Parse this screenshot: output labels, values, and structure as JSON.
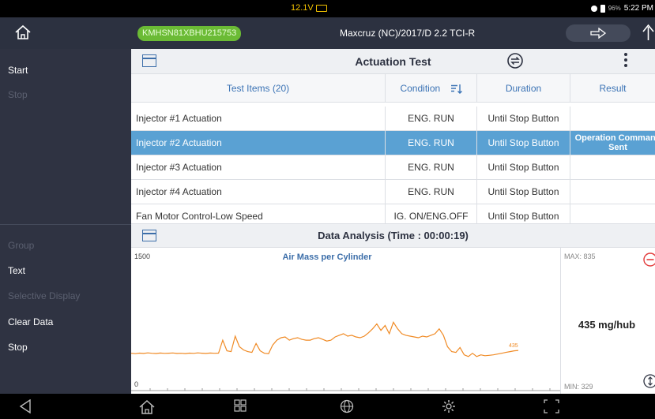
{
  "status_bar": {
    "voltage": "12.1V",
    "battery_percent": "96%",
    "time": "5:22 PM"
  },
  "header": {
    "vin": "KMHSN81XBHU215753",
    "vehicle": "Maxcruz (NC)/2017/D 2.2 TCI-R"
  },
  "sidebar": {
    "items": [
      {
        "label": "Start",
        "enabled": true
      },
      {
        "label": "Stop",
        "enabled": false
      },
      {
        "label": "Group",
        "enabled": false
      },
      {
        "label": "Text",
        "enabled": true
      },
      {
        "label": "Selective Display",
        "enabled": false
      },
      {
        "label": "Clear Data",
        "enabled": true
      },
      {
        "label": "Stop",
        "enabled": true
      }
    ]
  },
  "actuation": {
    "title": "Actuation Test",
    "columns": {
      "items": "Test Items (20)",
      "condition": "Condition",
      "duration": "Duration",
      "result": "Result"
    },
    "rows": [
      {
        "item": "Injector #1 Actuation",
        "condition": "ENG. RUN",
        "duration": "Until Stop Button",
        "result": ""
      },
      {
        "item": "Injector #2 Actuation",
        "condition": "ENG. RUN",
        "duration": "Until Stop Button",
        "result": "Operation Command\nSent"
      },
      {
        "item": "Injector #3 Actuation",
        "condition": "ENG. RUN",
        "duration": "Until Stop Button",
        "result": ""
      },
      {
        "item": "Injector #4 Actuation",
        "condition": "ENG. RUN",
        "duration": "Until Stop Button",
        "result": ""
      },
      {
        "item": "Fan Motor Control-Low Speed",
        "condition": "IG. ON/ENG.OFF",
        "duration": "Until Stop Button",
        "result": ""
      }
    ],
    "selected_row": 1
  },
  "data_analysis": {
    "title": "Data Analysis",
    "time": "(Time : 00:00:19)",
    "readout_value": "435 mg/hub",
    "max_label": "MAX: 835",
    "min_label": "MIN: 329"
  },
  "chart_data": {
    "type": "line",
    "title": "Air Mass per Cylinder",
    "ylim": [
      0,
      1500
    ],
    "y_max_label": "1500",
    "y_min_label": "0",
    "last_value_label": "435",
    "series": [
      {
        "color": "#f08a24",
        "values": [
          400,
          395,
          402,
          398,
          405,
          400,
          397,
          403,
          399,
          401,
          404,
          398,
          400,
          396,
          402,
          399,
          405,
          401,
          398,
          403,
          400,
          402,
          560,
          430,
          420,
          610,
          480,
          440,
          420,
          410,
          520,
          430,
          400,
          395,
          500,
          560,
          590,
          600,
          560,
          580,
          590,
          570,
          560,
          560,
          580,
          590,
          570,
          550,
          560,
          600,
          620,
          640,
          610,
          620,
          600,
          590,
          610,
          650,
          700,
          760,
          680,
          740,
          640,
          780,
          700,
          640,
          620,
          610,
          600,
          590,
          610,
          600,
          620,
          640,
          700,
          620,
          480,
          420,
          410,
          470,
          380,
          360,
          400,
          360,
          380,
          370,
          375,
          380,
          390,
          400,
          410,
          420,
          430,
          435
        ]
      }
    ]
  }
}
